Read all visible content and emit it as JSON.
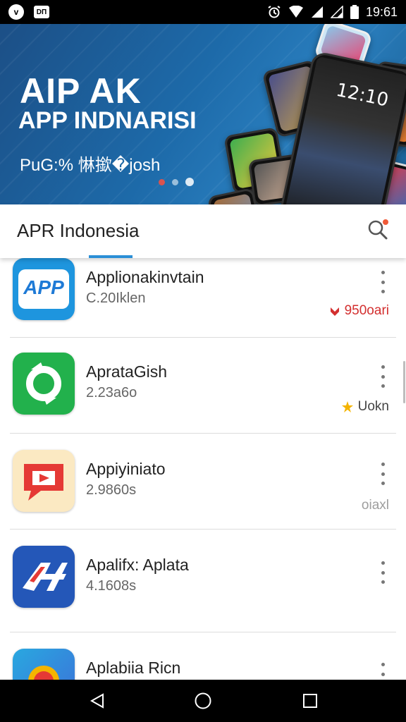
{
  "status_bar": {
    "time": "19:61",
    "left_icon_1": "v",
    "left_icon_2": "DП",
    "icons": [
      "alarm-icon",
      "wifi-icon",
      "signal-icon",
      "signal-icon",
      "battery-icon"
    ]
  },
  "banner": {
    "title": "AIP AK",
    "subtitle": "APP INDNARISI",
    "tagline": "PuG:% 惏撳�josh",
    "phone_time": "12:10"
  },
  "header": {
    "title": "APR Indonesia",
    "search_icon": "search-icon"
  },
  "apps": [
    {
      "name": "Applionakinvtain",
      "sub": "C.20Iklen",
      "badge": "950oari",
      "badge_color": "#d32f2f",
      "icon_text": "APP"
    },
    {
      "name": "AprataGish",
      "sub": "2.23a6o",
      "badge": "Uokn",
      "badge_color": "#444444"
    },
    {
      "name": "Appiyiniato",
      "sub": "2.9860s",
      "badge": "oiaxl",
      "badge_color": "#9e9e9e"
    },
    {
      "name": "Apalifx: Aplata",
      "sub": "4.1608s",
      "badge": "",
      "badge_color": "#444444"
    },
    {
      "name": "Aplabiia Ricn",
      "sub": "",
      "badge": "",
      "badge_color": "#444444"
    }
  ],
  "colors": {
    "accent": "#2b8fd6",
    "banner": "#1d6aa9",
    "notification": "#f05a38"
  }
}
